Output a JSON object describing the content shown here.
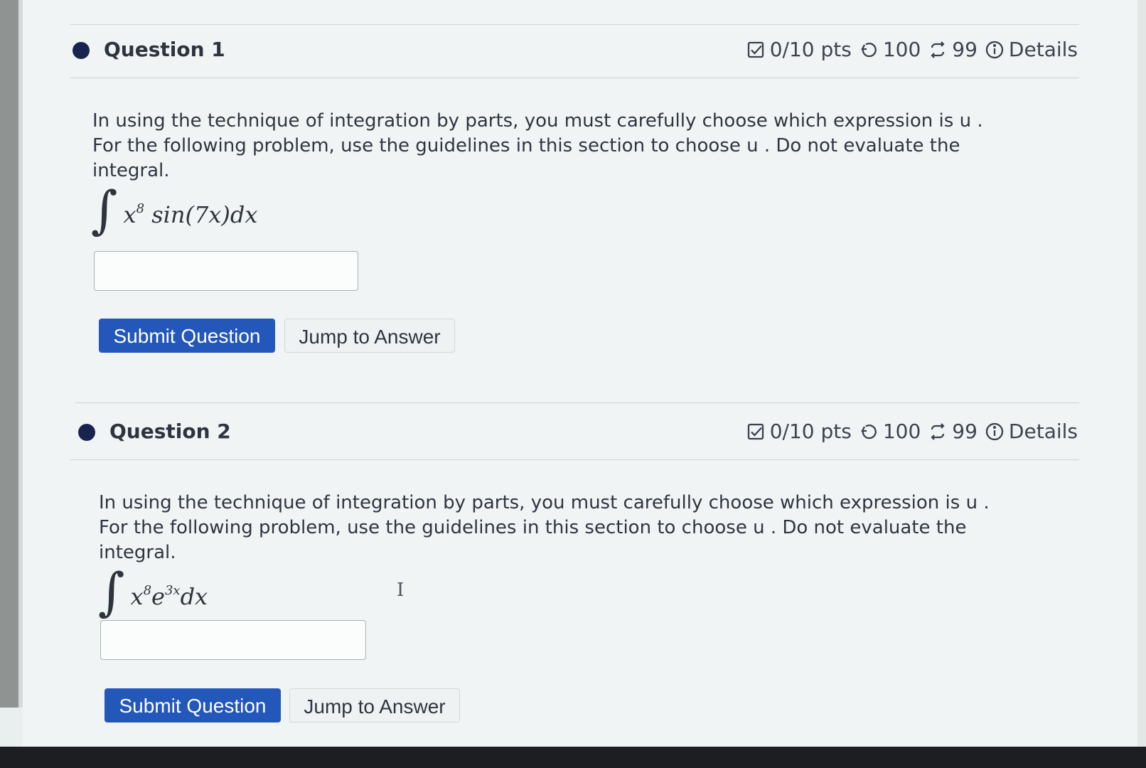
{
  "questions": [
    {
      "title": "Question 1",
      "points": "0/10 pts",
      "attempts": "100",
      "retries": "99",
      "details_label": "Details",
      "prompt": "In using the technique of integration by parts, you must carefully choose which expression is u . For the following problem, use the guidelines in this section to choose u . Do not evaluate the integral.",
      "integral": {
        "sign": "∫",
        "base": "x",
        "exponent": "8",
        "rest": " sin(7x)dx"
      },
      "answer_value": "",
      "submit_label": "Submit Question",
      "jump_label": "Jump to Answer"
    },
    {
      "title": "Question 2",
      "points": "0/10 pts",
      "attempts": "100",
      "retries": "99",
      "details_label": "Details",
      "prompt": "In using the technique of integration by parts, you must carefully choose which expression is u . For the following problem, use the guidelines in this section to choose u . Do not evaluate the integral.",
      "integral": {
        "sign": "∫",
        "base": "x",
        "exponent": "8",
        "base_2": "e",
        "exponent_2": "3x",
        "rest": "dx"
      },
      "answer_value": "",
      "submit_label": "Submit Question",
      "jump_label": "Jump to Answer"
    }
  ],
  "icons": {
    "status_dot": "filled-circle",
    "points": "checkbox-icon",
    "attempts": "undo-icon",
    "retries": "repeat-icon",
    "details": "info-icon"
  },
  "colors": {
    "accent": "#2357b9",
    "dot": "#18244f",
    "text": "#2f3540",
    "background": "#f0f4f4"
  },
  "cursor_glyph": "I"
}
